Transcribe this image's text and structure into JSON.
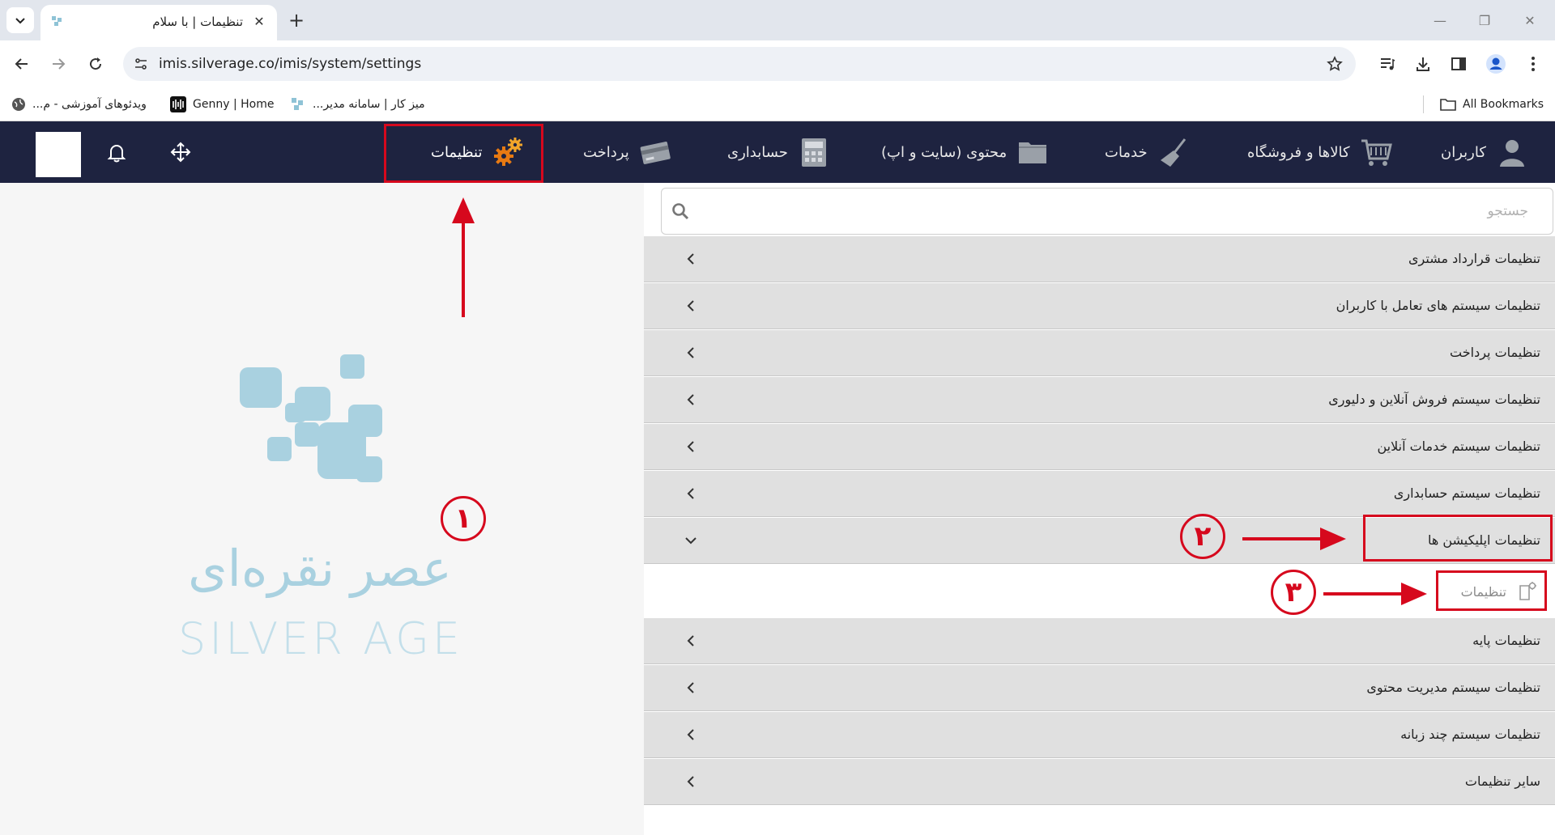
{
  "browser": {
    "tab_title": "تنظیمات | با سلام",
    "url": "imis.silverage.co/imis/system/settings",
    "bookmarks": [
      {
        "label": "ویدئوهای آموزشی - م..."
      },
      {
        "label": "Genny | Home"
      },
      {
        "label": "میز کار | سامانه مدیر..."
      }
    ],
    "all_bookmarks_label": "All Bookmarks"
  },
  "header": {
    "menu": [
      {
        "label": "کاربران",
        "icon": "user-icon"
      },
      {
        "label": "کالاها و فروشگاه",
        "icon": "cart-icon"
      },
      {
        "label": "خدمات",
        "icon": "broom-icon"
      },
      {
        "label": "محتوی (سایت و اپ)",
        "icon": "folder-icon"
      },
      {
        "label": "حسابداری",
        "icon": "calculator-icon"
      },
      {
        "label": "پرداخت",
        "icon": "credit-card-icon"
      },
      {
        "label": "تنظیمات",
        "icon": "gears-icon"
      }
    ]
  },
  "logo": {
    "persian_text": "عصر نقره‌ای",
    "latin_text": "SILVER AGE"
  },
  "search": {
    "placeholder": "جستجو"
  },
  "settings_groups": [
    {
      "label": "تنظیمات قرارداد مشتری"
    },
    {
      "label": "تنظیمات سیستم های تعامل با کاربران"
    },
    {
      "label": "تنظیمات پرداخت"
    },
    {
      "label": "تنظیمات سیستم فروش آنلاین و دلیوری"
    },
    {
      "label": "تنظیمات سیستم خدمات آنلاین"
    },
    {
      "label": "تنظیمات سیستم حسابداری"
    },
    {
      "label": "تنظیمات اپلیکیشن ها",
      "expanded": true,
      "sub_items": [
        {
          "label": "تنظیمات"
        }
      ]
    },
    {
      "label": "تنظیمات پایه"
    },
    {
      "label": "تنظیمات سیستم مدیریت محتوی"
    },
    {
      "label": "تنظیمات سیستم چند زبانه"
    },
    {
      "label": "سایر تنظیمات"
    }
  ],
  "annotations": [
    "۱",
    "۲",
    "۳"
  ],
  "colors": {
    "header_bg": "#1e2340",
    "annotation_red": "#d6081d",
    "accordion_bg": "#e0e0e0",
    "logo_blue": "#a9d1e0"
  }
}
